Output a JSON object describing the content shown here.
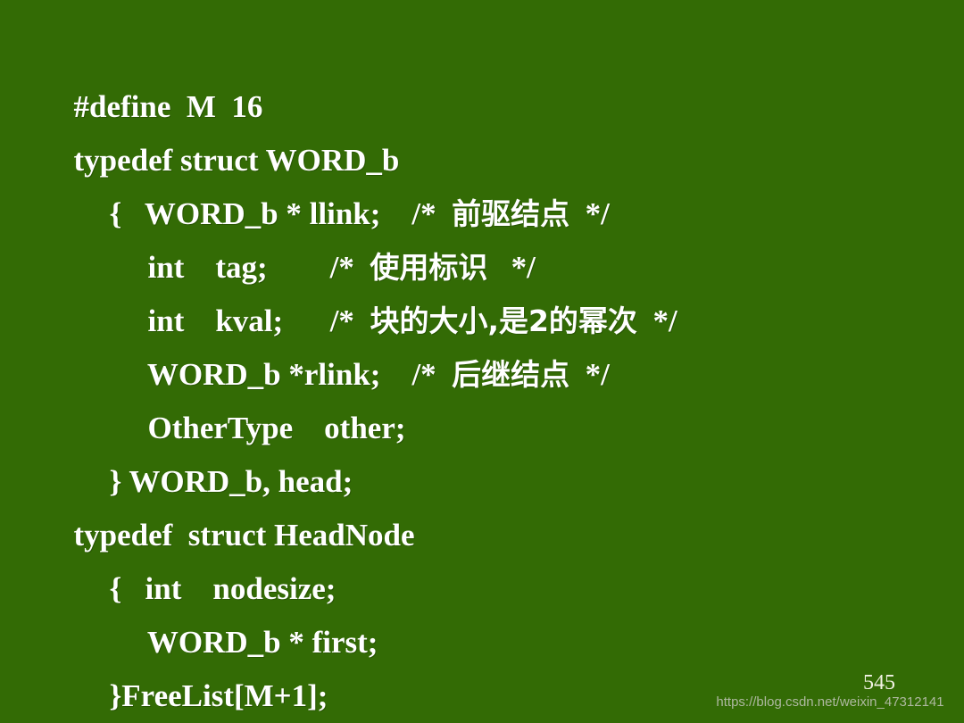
{
  "slide": {
    "background_color": "#336B05",
    "text_color": "#FFFFFF",
    "page_number": "545",
    "watermark": "https://blog.csdn.net/weixin_47312141",
    "page_number_color": "#F2F2E4",
    "watermark_color": "#B9BFAE"
  },
  "code": {
    "lines": [
      {
        "indent": 0,
        "text": "#define  M  16"
      },
      {
        "indent": 0,
        "text": "typedef struct WORD_b"
      },
      {
        "indent": 1,
        "code": "{   WORD_b * llink;    ",
        "comment_open": "/*  ",
        "comment_cjk": "前驱结点",
        "comment_close": "  */"
      },
      {
        "indent": 2,
        "code": "int    tag;        ",
        "comment_open": "/*  ",
        "comment_cjk": "使用标识",
        "comment_close": "   */"
      },
      {
        "indent": 2,
        "code": "int    kval;      ",
        "comment_open": "/*  ",
        "comment_cjk": "块的大小,是2的幂次",
        "comment_close": "  */"
      },
      {
        "indent": 2,
        "code": "WORD_b *rlink;    ",
        "comment_open": "/*  ",
        "comment_cjk": "后继结点",
        "comment_close": "  */"
      },
      {
        "indent": 2,
        "text": "OtherType    other;"
      },
      {
        "indent": 1,
        "text": "} WORD_b, head;"
      },
      {
        "indent": 0,
        "text": "typedef  struct HeadNode"
      },
      {
        "indent": 1,
        "text": "{   int    nodesize;"
      },
      {
        "indent": 2,
        "text": "WORD_b * first;"
      },
      {
        "indent": 1,
        "text": "}FreeList[M+1];"
      }
    ]
  }
}
